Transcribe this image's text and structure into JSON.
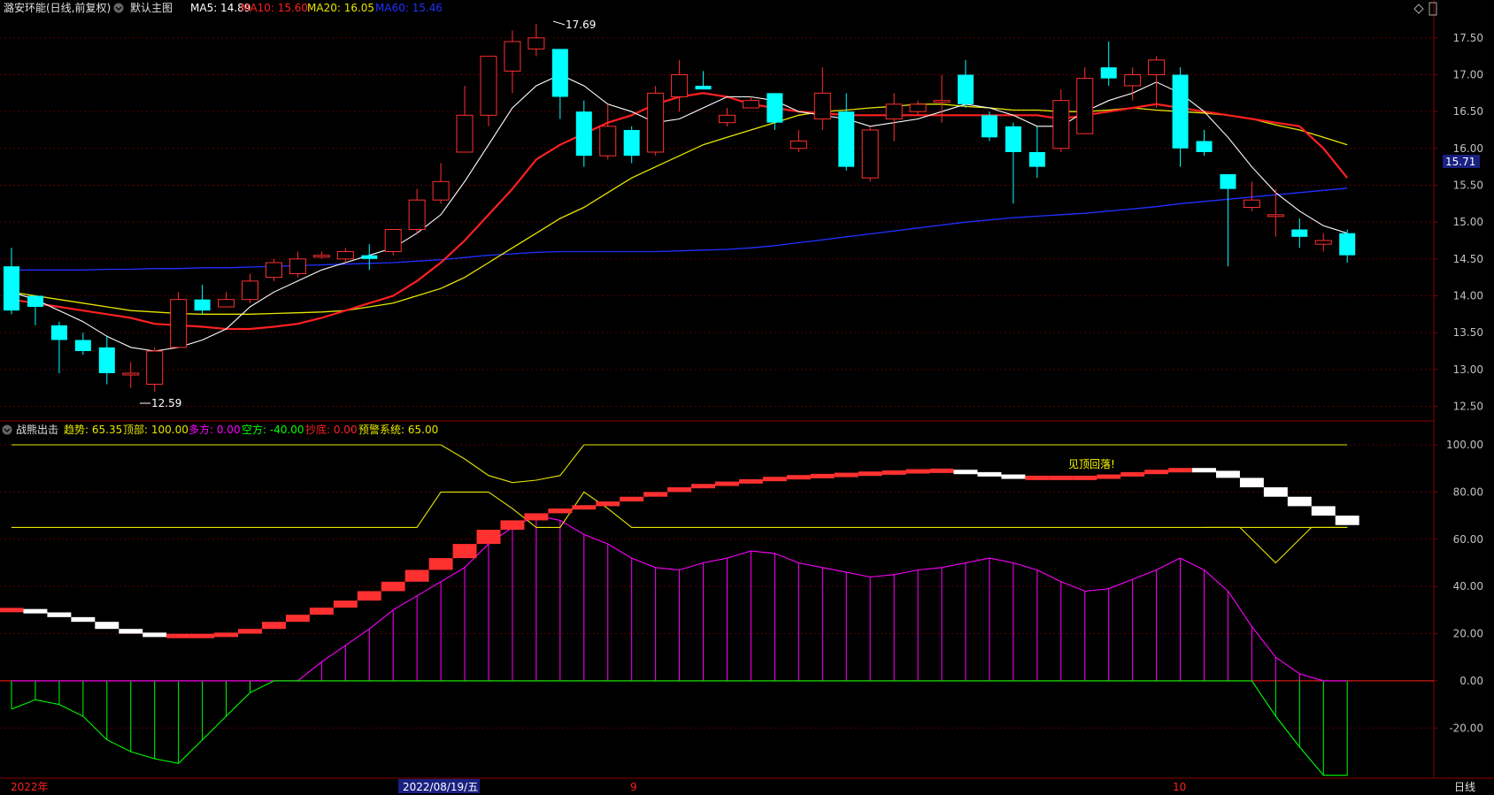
{
  "header": {
    "stock_title": "潞安环能(日线,前复权)",
    "main_chart": "默认主图",
    "ma5": "MA5: 14.89",
    "ma10": "MA10: 15.60",
    "ma20": "MA20: 16.05",
    "ma60": "MA60: 15.46"
  },
  "indicator_header": {
    "name": "战熊出击",
    "trend": "趋势: 65.35",
    "top": "顶部: 100.00",
    "bull": "多方: 0.00",
    "bear": "空方: -40.00",
    "bottom": "抄底: 0.00",
    "warn": "预警系统: 65.00"
  },
  "annotations": {
    "high": "17.69",
    "low": "12.59",
    "signal": "见顶回落!",
    "current_price": "15.71"
  },
  "x_labels": {
    "year": "2022年",
    "cursor_date": "2022/08/19/五",
    "sep": "9",
    "oct": "10",
    "period": "日线"
  },
  "colors": {
    "up": "#ff3030",
    "down": "#00ffff",
    "ma5": "#ffffff",
    "ma10": "#ff2020",
    "ma20": "#e6e600",
    "ma60": "#2030ff",
    "magenta": "#ff00ff",
    "green": "#00ff00"
  },
  "chart_data": [
    {
      "type": "candlestick",
      "y_ticks": [
        "17.50",
        "17.00",
        "16.50",
        "16.00",
        "15.50",
        "15.00",
        "14.50",
        "14.00",
        "13.50",
        "13.00",
        "12.50"
      ],
      "ylim": [
        12.35,
        17.75
      ],
      "candles": [
        [
          14.4,
          13.8,
          14.65,
          13.75
        ],
        [
          14.0,
          13.85,
          14.0,
          13.6
        ],
        [
          13.6,
          13.4,
          13.65,
          12.95
        ],
        [
          13.4,
          13.25,
          13.5,
          13.2
        ],
        [
          13.3,
          12.95,
          13.45,
          12.8
        ],
        [
          12.95,
          12.95,
          13.1,
          12.75
        ],
        [
          12.8,
          13.25,
          13.3,
          12.7
        ],
        [
          13.3,
          13.95,
          14.05,
          13.3
        ],
        [
          13.95,
          13.8,
          14.15,
          13.75
        ],
        [
          13.85,
          13.95,
          14.05,
          13.85
        ],
        [
          13.95,
          14.2,
          14.3,
          13.9
        ],
        [
          14.25,
          14.45,
          14.5,
          14.2
        ],
        [
          14.3,
          14.5,
          14.6,
          14.25
        ],
        [
          14.55,
          14.55,
          14.6,
          14.5
        ],
        [
          14.5,
          14.6,
          14.65,
          14.45
        ],
        [
          14.55,
          14.5,
          14.7,
          14.35
        ],
        [
          14.6,
          14.9,
          14.9,
          14.55
        ],
        [
          14.9,
          15.3,
          15.45,
          14.85
        ],
        [
          15.3,
          15.55,
          15.8,
          15.25
        ],
        [
          15.95,
          16.45,
          16.85,
          15.95
        ],
        [
          16.45,
          17.25,
          17.25,
          16.3
        ],
        [
          17.05,
          17.45,
          17.6,
          16.75
        ],
        [
          17.35,
          17.5,
          17.69,
          17.25
        ],
        [
          17.35,
          16.7,
          17.35,
          16.4
        ],
        [
          16.5,
          15.9,
          16.65,
          15.75
        ],
        [
          15.9,
          16.3,
          16.6,
          15.85
        ],
        [
          16.25,
          15.9,
          16.3,
          15.8
        ],
        [
          15.95,
          16.75,
          16.85,
          15.9
        ],
        [
          16.7,
          17.0,
          17.2,
          16.5
        ],
        [
          16.85,
          16.8,
          17.05,
          16.8
        ],
        [
          16.35,
          16.45,
          16.55,
          16.3
        ],
        [
          16.55,
          16.65,
          16.7,
          16.55
        ],
        [
          16.75,
          16.35,
          16.75,
          16.25
        ],
        [
          16.0,
          16.1,
          16.25,
          15.95
        ],
        [
          16.4,
          16.75,
          17.1,
          16.25
        ],
        [
          16.5,
          15.75,
          16.75,
          15.7
        ],
        [
          15.6,
          16.25,
          16.3,
          15.55
        ],
        [
          16.4,
          16.6,
          16.75,
          16.1
        ],
        [
          16.5,
          16.6,
          16.65,
          16.45
        ],
        [
          16.65,
          16.65,
          17.0,
          16.35
        ],
        [
          17.0,
          16.6,
          17.2,
          16.55
        ],
        [
          16.45,
          16.15,
          16.5,
          16.1
        ],
        [
          16.3,
          15.95,
          16.35,
          15.25
        ],
        [
          15.95,
          15.75,
          16.3,
          15.6
        ],
        [
          16.0,
          16.65,
          16.8,
          15.95
        ],
        [
          16.2,
          16.95,
          17.1,
          16.2
        ],
        [
          17.1,
          16.95,
          17.45,
          16.85
        ],
        [
          16.85,
          17.0,
          17.1,
          16.65
        ],
        [
          17.0,
          17.2,
          17.25,
          16.55
        ],
        [
          17.0,
          16.0,
          17.1,
          15.75
        ],
        [
          16.1,
          15.95,
          16.25,
          15.9
        ],
        [
          15.65,
          15.45,
          15.65,
          14.4
        ],
        [
          15.2,
          15.3,
          15.55,
          15.15
        ],
        [
          15.1,
          15.1,
          15.45,
          14.8
        ],
        [
          14.9,
          14.8,
          15.05,
          14.65
        ],
        [
          14.7,
          14.75,
          14.85,
          14.6
        ],
        [
          14.85,
          14.55,
          14.9,
          14.45
        ]
      ],
      "ma5": [
        14.05,
        13.95,
        13.8,
        13.65,
        13.45,
        13.3,
        13.25,
        13.3,
        13.4,
        13.55,
        13.85,
        14.05,
        14.2,
        14.35,
        14.45,
        14.55,
        14.65,
        14.85,
        15.1,
        15.55,
        16.05,
        16.55,
        16.85,
        17.0,
        16.85,
        16.6,
        16.5,
        16.35,
        16.4,
        16.55,
        16.7,
        16.7,
        16.65,
        16.5,
        16.45,
        16.4,
        16.3,
        16.35,
        16.4,
        16.5,
        16.6,
        16.55,
        16.45,
        16.3,
        16.3,
        16.5,
        16.65,
        16.75,
        16.9,
        16.75,
        16.5,
        16.15,
        15.75,
        15.4,
        15.15,
        14.95,
        14.85
      ],
      "ma10": [
        13.95,
        13.9,
        13.85,
        13.8,
        13.75,
        13.7,
        13.62,
        13.6,
        13.58,
        13.55,
        13.55,
        13.58,
        13.62,
        13.7,
        13.8,
        13.9,
        14.0,
        14.2,
        14.45,
        14.75,
        15.1,
        15.45,
        15.85,
        16.05,
        16.2,
        16.35,
        16.45,
        16.6,
        16.7,
        16.75,
        16.7,
        16.6,
        16.55,
        16.5,
        16.48,
        16.45,
        16.45,
        16.45,
        16.45,
        16.45,
        16.45,
        16.45,
        16.45,
        16.45,
        16.4,
        16.45,
        16.5,
        16.55,
        16.6,
        16.55,
        16.5,
        16.45,
        16.4,
        16.35,
        16.3,
        16.0,
        15.6
      ],
      "ma20": [
        14.05,
        14.0,
        13.95,
        13.9,
        13.85,
        13.8,
        13.78,
        13.76,
        13.75,
        13.75,
        13.75,
        13.76,
        13.77,
        13.78,
        13.8,
        13.85,
        13.9,
        14.0,
        14.1,
        14.25,
        14.45,
        14.65,
        14.85,
        15.05,
        15.2,
        15.4,
        15.6,
        15.75,
        15.9,
        16.05,
        16.15,
        16.25,
        16.35,
        16.45,
        16.5,
        16.52,
        16.55,
        16.57,
        16.6,
        16.6,
        16.57,
        16.55,
        16.52,
        16.52,
        16.5,
        16.5,
        16.52,
        16.55,
        16.52,
        16.5,
        16.48,
        16.45,
        16.4,
        16.32,
        16.25,
        16.15,
        16.05
      ],
      "ma60": [
        14.35,
        14.35,
        14.35,
        14.35,
        14.36,
        14.36,
        14.37,
        14.37,
        14.38,
        14.38,
        14.39,
        14.4,
        14.41,
        14.42,
        14.43,
        14.44,
        14.45,
        14.47,
        14.49,
        14.52,
        14.55,
        14.57,
        14.59,
        14.6,
        14.6,
        14.6,
        14.6,
        14.6,
        14.61,
        14.62,
        14.63,
        14.65,
        14.68,
        14.72,
        14.76,
        14.8,
        14.84,
        14.88,
        14.92,
        14.96,
        15.0,
        15.03,
        15.06,
        15.08,
        15.1,
        15.12,
        15.15,
        15.18,
        15.21,
        15.25,
        15.28,
        15.31,
        15.34,
        15.37,
        15.4,
        15.43,
        15.46
      ]
    },
    {
      "type": "indicator",
      "y_ticks": [
        "100.00",
        "80.00",
        "60.00",
        "40.00",
        "20.00",
        "0.00",
        "-20.00"
      ],
      "ylim": [
        -40.5,
        103
      ],
      "top_line": [
        100,
        100,
        100,
        100,
        100,
        100,
        100,
        100,
        100,
        100,
        100,
        100,
        100,
        100,
        100,
        100,
        100,
        100,
        100,
        94,
        87,
        84,
        85,
        87,
        100,
        100,
        100,
        100,
        100,
        100,
        100,
        100,
        100,
        100,
        100,
        100,
        100,
        100,
        100,
        100,
        100,
        100,
        100,
        100,
        100,
        100,
        100,
        100,
        100,
        100,
        100,
        100,
        100,
        100,
        100,
        100,
        100
      ],
      "warn_line": [
        65,
        65,
        65,
        65,
        65,
        65,
        65,
        65,
        65,
        65,
        65,
        65,
        65,
        65,
        65,
        65,
        65,
        65,
        80,
        80,
        80,
        73,
        65,
        65,
        80,
        73,
        65,
        65,
        65,
        65,
        65,
        65,
        65,
        65,
        65,
        65,
        65,
        65,
        65,
        65,
        65,
        65,
        65,
        65,
        65,
        65,
        65,
        65,
        65,
        65,
        65,
        65,
        65,
        65,
        65,
        65,
        65
      ],
      "warn_line_tail": [
        65,
        65,
        50,
        65,
        65
      ],
      "trend": [
        30,
        29,
        27,
        25,
        22,
        20,
        19,
        19,
        19,
        20,
        22,
        25,
        28,
        31,
        34,
        38,
        42,
        47,
        52,
        58,
        64,
        68,
        71,
        73,
        74,
        76,
        78,
        80,
        82,
        83,
        84,
        85,
        86,
        86.5,
        87,
        87.5,
        88,
        88.5,
        89,
        89,
        88,
        87,
        86,
        86,
        86,
        86,
        87,
        88,
        89,
        89.5,
        89,
        86,
        82,
        78,
        74,
        70,
        66
      ],
      "magenta": [
        -12,
        -10,
        -8,
        -12,
        -18,
        -25,
        -30,
        -34,
        -35,
        -30,
        -20,
        -10,
        0,
        8,
        15,
        22,
        30,
        36,
        42,
        48,
        58,
        65,
        70,
        68,
        62,
        58,
        52,
        48,
        47,
        50,
        52,
        55,
        54,
        50,
        48,
        46,
        44,
        45,
        47,
        48,
        50,
        52,
        50,
        47,
        42,
        38,
        39,
        43,
        47,
        52,
        47,
        38,
        23,
        10,
        3,
        -3,
        -5
      ],
      "green": [
        -12,
        -8,
        -10,
        -15,
        -25,
        -30,
        -33,
        -35,
        -25,
        -15,
        -5,
        0,
        0,
        0,
        0,
        0,
        0,
        0,
        0,
        0,
        0,
        0,
        0,
        0,
        0,
        0,
        0,
        0,
        0,
        0,
        0,
        0,
        0,
        0,
        0,
        0,
        0,
        0,
        0,
        0,
        0,
        0,
        0,
        0,
        0,
        0,
        0,
        0,
        0,
        0,
        0,
        0,
        0,
        -15,
        -28,
        -40,
        -40
      ]
    }
  ]
}
